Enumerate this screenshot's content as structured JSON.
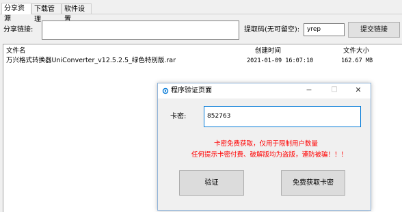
{
  "tabs": [
    "分享资源",
    "下载管理",
    "软件设置"
  ],
  "share": {
    "link_label": "分享链接:",
    "link_value": "",
    "code_label": "提取码(无可留空):",
    "code_value": "yrep",
    "submit_label": "提交链接"
  },
  "list": {
    "headers": [
      "文件名",
      "创建时间",
      "文件大小"
    ],
    "rows": [
      {
        "name": "万兴格式转换器UniConverter_v12.5.2.5_绿色特别版.rar",
        "time": "2021-01-09 16:07:10",
        "size": "162.67 MB"
      }
    ]
  },
  "dialog": {
    "title": "程序验证页面",
    "key_label": "卡密:",
    "key_value": "852763",
    "notice1": "卡密免费获取，仅用于限制用户数量",
    "notice2": "任何提示卡密付费、破解版均为盗版，谨防被骗！！！",
    "verify_label": "验证",
    "free_label": "免费获取卡密",
    "minimize_glyph": "−",
    "maximize_glyph": "□",
    "close_glyph": "✕"
  },
  "colors": {
    "accent": "#0078d7",
    "warning": "#ff0000",
    "dialog_border": "#8fb3d9"
  }
}
